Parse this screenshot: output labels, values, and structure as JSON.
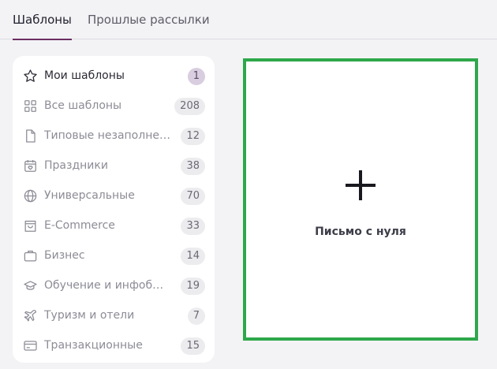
{
  "tabs": [
    {
      "label": "Шаблоны",
      "active": true
    },
    {
      "label": "Прошлые рассылки",
      "active": false
    }
  ],
  "sidebar": {
    "items": [
      {
        "label": "Мои шаблоны",
        "count": "1",
        "icon": "star-icon"
      },
      {
        "label": "Все шаблоны",
        "count": "208",
        "icon": "grid-icon"
      },
      {
        "label": "Типовые незаполнен…",
        "count": "12",
        "icon": "document-icon"
      },
      {
        "label": "Праздники",
        "count": "38",
        "icon": "calendar-heart-icon"
      },
      {
        "label": "Универсальные",
        "count": "70",
        "icon": "globe-icon"
      },
      {
        "label": "E-Commerce",
        "count": "33",
        "icon": "shopping-bag-icon"
      },
      {
        "label": "Бизнес",
        "count": "14",
        "icon": "briefcase-icon"
      },
      {
        "label": "Обучение и инфобиз…",
        "count": "19",
        "icon": "graduation-cap-icon"
      },
      {
        "label": "Туризм и отели",
        "count": "7",
        "icon": "airplane-icon"
      },
      {
        "label": "Транзакционные",
        "count": "15",
        "icon": "credit-card-icon"
      }
    ]
  },
  "create_card": {
    "label": "Письмо с нуля",
    "icon": "plus-icon",
    "border_color": "#2ea84a"
  },
  "colors": {
    "accent": "#6b2d62",
    "active_badge": "#d9cde0"
  }
}
